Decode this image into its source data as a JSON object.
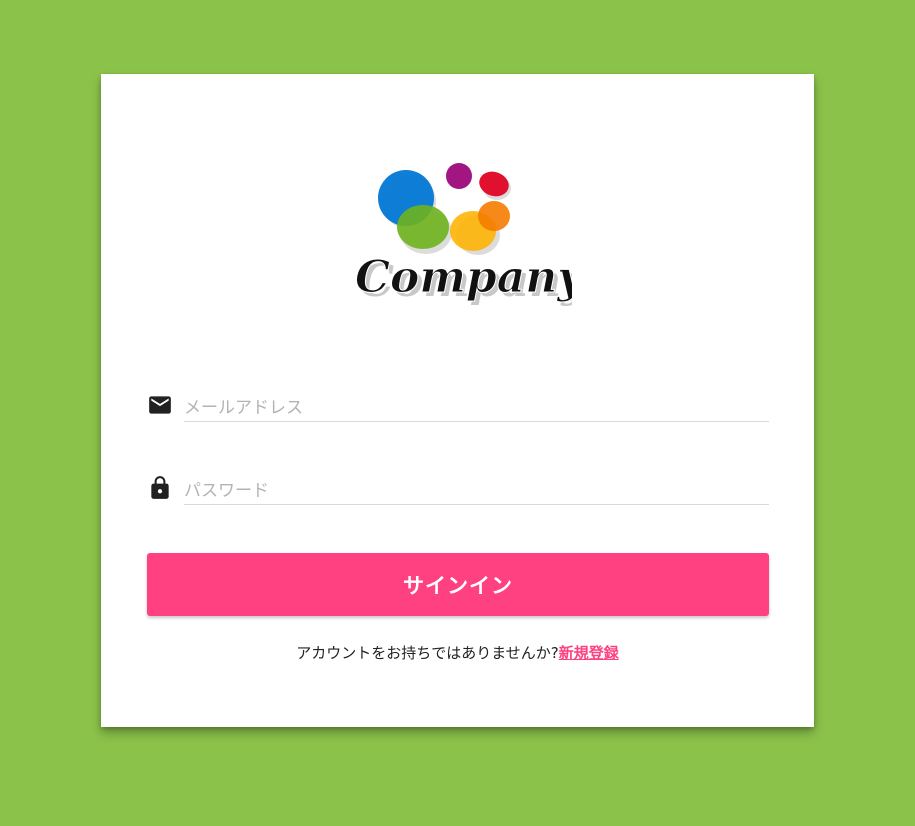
{
  "colors": {
    "background": "#8bc34a",
    "card": "#ffffff",
    "accent": "#ff4081"
  },
  "logo": {
    "text": "Company"
  },
  "form": {
    "email": {
      "icon": "mail-icon",
      "placeholder": "メールアドレス",
      "value": ""
    },
    "password": {
      "icon": "lock-icon",
      "placeholder": "パスワード",
      "value": ""
    },
    "signin_label": "サインイン"
  },
  "signup": {
    "prompt": "アカウントをお持ちではありませんか?",
    "link": "新規登録"
  }
}
